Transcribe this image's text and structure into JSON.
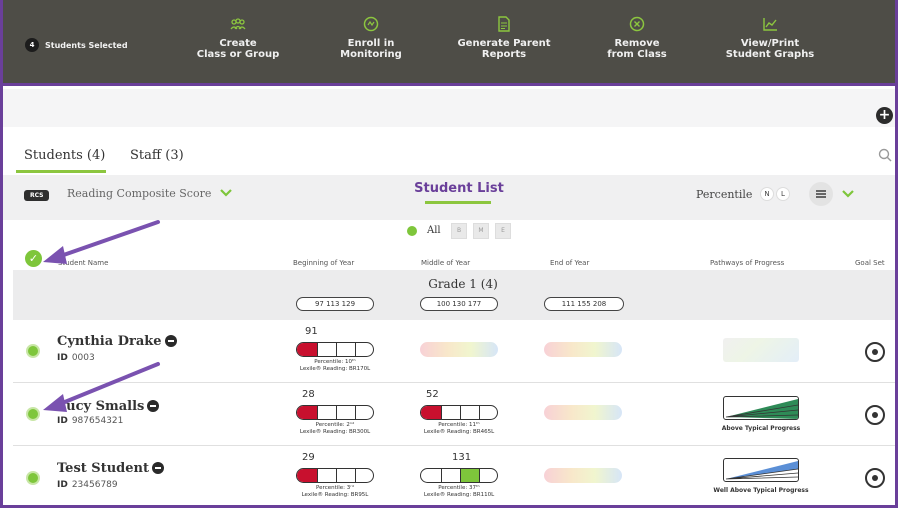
{
  "toolbar": {
    "selected_count": "4",
    "selected_label": "Students Selected",
    "actions": [
      {
        "label_line1": "Create",
        "label_line2": "Class or Group",
        "icon": "group-icon"
      },
      {
        "label_line1": "Enroll in",
        "label_line2": "Monitoring",
        "icon": "monitoring-icon"
      },
      {
        "label_line1": "Generate Parent",
        "label_line2": "Reports",
        "icon": "report-icon"
      },
      {
        "label_line1": "Remove",
        "label_line2": "from Class",
        "icon": "remove-icon"
      },
      {
        "label_line1": "View/Print",
        "label_line2": "Student Graphs",
        "icon": "graph-icon"
      }
    ],
    "accent": "#8cc63f",
    "background": "#4e4d47"
  },
  "tabs": {
    "students": "Students (4)",
    "staff": "Staff (3)"
  },
  "filters": {
    "score_badge": "RCS",
    "score_label": "Reading Composite Score",
    "list_title": "Student List",
    "percentile_label": "Percentile",
    "toggle_n": "N",
    "toggle_l": "L",
    "all_label": "All",
    "period_boxes": [
      "B",
      "M",
      "E"
    ]
  },
  "columns": {
    "student_name": "Student Name",
    "boy": "Beginning of Year",
    "moy": "Middle of Year",
    "eoy": "End of Year",
    "pathways": "Pathways of Progress",
    "goal_set": "Goal Set"
  },
  "grade": {
    "label": "Grade 1 (4)",
    "boy_range": "97   113   129",
    "moy_range": "100   130   177",
    "eoy_range": "111   155   208"
  },
  "students": [
    {
      "name": "Cynthia Drake",
      "id_label": "ID",
      "id": "0003",
      "boy_score": "91",
      "boy_percentile": "Percentile: 10ᵗʰ",
      "boy_lexile": "Lexile® Reading: BR170L",
      "moy_score": "",
      "pathway": ""
    },
    {
      "name": "Lucy Smalls",
      "id_label": "ID",
      "id": "987654321",
      "boy_score": "28",
      "boy_percentile": "Percentile: 2ⁿᵈ",
      "boy_lexile": "Lexile® Reading: BR300L",
      "moy_score": "52",
      "moy_percentile": "Percentile: 11ᵗʰ",
      "moy_lexile": "Lexile® Reading: BR465L",
      "pathway": "Above Typical Progress"
    },
    {
      "name": "Test Student",
      "id_label": "ID",
      "id": "23456789",
      "boy_score": "29",
      "boy_percentile": "Percentile: 3ʳᵈ",
      "boy_lexile": "Lexile® Reading: BR95L",
      "moy_score": "131",
      "moy_percentile": "Percentile: 37ᵗʰ",
      "moy_lexile": "Lexile® Reading: BR110L",
      "pathway": "Well Above Typical Progress"
    }
  ],
  "colors": {
    "purple": "#6a3f9a",
    "green": "#7ec63b",
    "red": "#c8102e"
  }
}
